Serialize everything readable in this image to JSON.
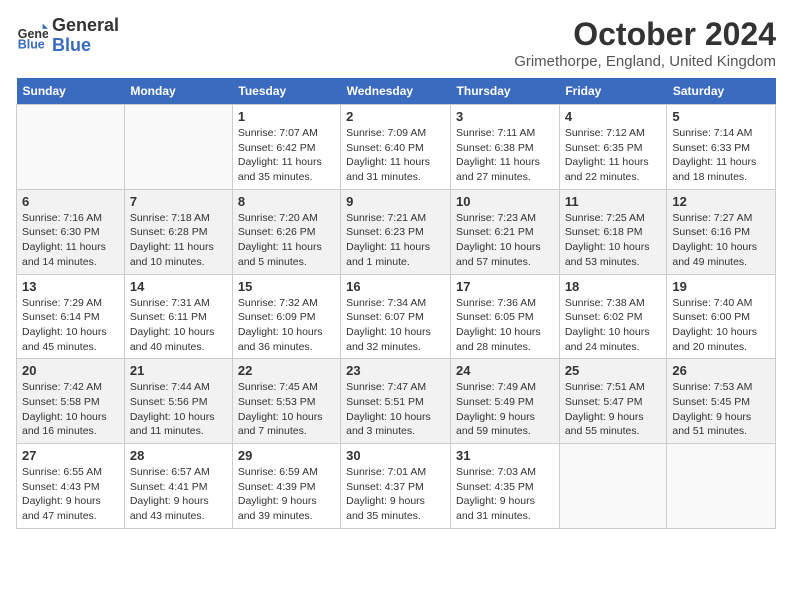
{
  "header": {
    "logo_line1": "General",
    "logo_line2": "Blue",
    "month": "October 2024",
    "location": "Grimethorpe, England, United Kingdom"
  },
  "weekdays": [
    "Sunday",
    "Monday",
    "Tuesday",
    "Wednesday",
    "Thursday",
    "Friday",
    "Saturday"
  ],
  "weeks": [
    [
      {
        "day": null
      },
      {
        "day": null
      },
      {
        "day": "1",
        "sunrise": "Sunrise: 7:07 AM",
        "sunset": "Sunset: 6:42 PM",
        "daylight": "Daylight: 11 hours and 35 minutes."
      },
      {
        "day": "2",
        "sunrise": "Sunrise: 7:09 AM",
        "sunset": "Sunset: 6:40 PM",
        "daylight": "Daylight: 11 hours and 31 minutes."
      },
      {
        "day": "3",
        "sunrise": "Sunrise: 7:11 AM",
        "sunset": "Sunset: 6:38 PM",
        "daylight": "Daylight: 11 hours and 27 minutes."
      },
      {
        "day": "4",
        "sunrise": "Sunrise: 7:12 AM",
        "sunset": "Sunset: 6:35 PM",
        "daylight": "Daylight: 11 hours and 22 minutes."
      },
      {
        "day": "5",
        "sunrise": "Sunrise: 7:14 AM",
        "sunset": "Sunset: 6:33 PM",
        "daylight": "Daylight: 11 hours and 18 minutes."
      }
    ],
    [
      {
        "day": "6",
        "sunrise": "Sunrise: 7:16 AM",
        "sunset": "Sunset: 6:30 PM",
        "daylight": "Daylight: 11 hours and 14 minutes."
      },
      {
        "day": "7",
        "sunrise": "Sunrise: 7:18 AM",
        "sunset": "Sunset: 6:28 PM",
        "daylight": "Daylight: 11 hours and 10 minutes."
      },
      {
        "day": "8",
        "sunrise": "Sunrise: 7:20 AM",
        "sunset": "Sunset: 6:26 PM",
        "daylight": "Daylight: 11 hours and 5 minutes."
      },
      {
        "day": "9",
        "sunrise": "Sunrise: 7:21 AM",
        "sunset": "Sunset: 6:23 PM",
        "daylight": "Daylight: 11 hours and 1 minute."
      },
      {
        "day": "10",
        "sunrise": "Sunrise: 7:23 AM",
        "sunset": "Sunset: 6:21 PM",
        "daylight": "Daylight: 10 hours and 57 minutes."
      },
      {
        "day": "11",
        "sunrise": "Sunrise: 7:25 AM",
        "sunset": "Sunset: 6:18 PM",
        "daylight": "Daylight: 10 hours and 53 minutes."
      },
      {
        "day": "12",
        "sunrise": "Sunrise: 7:27 AM",
        "sunset": "Sunset: 6:16 PM",
        "daylight": "Daylight: 10 hours and 49 minutes."
      }
    ],
    [
      {
        "day": "13",
        "sunrise": "Sunrise: 7:29 AM",
        "sunset": "Sunset: 6:14 PM",
        "daylight": "Daylight: 10 hours and 45 minutes."
      },
      {
        "day": "14",
        "sunrise": "Sunrise: 7:31 AM",
        "sunset": "Sunset: 6:11 PM",
        "daylight": "Daylight: 10 hours and 40 minutes."
      },
      {
        "day": "15",
        "sunrise": "Sunrise: 7:32 AM",
        "sunset": "Sunset: 6:09 PM",
        "daylight": "Daylight: 10 hours and 36 minutes."
      },
      {
        "day": "16",
        "sunrise": "Sunrise: 7:34 AM",
        "sunset": "Sunset: 6:07 PM",
        "daylight": "Daylight: 10 hours and 32 minutes."
      },
      {
        "day": "17",
        "sunrise": "Sunrise: 7:36 AM",
        "sunset": "Sunset: 6:05 PM",
        "daylight": "Daylight: 10 hours and 28 minutes."
      },
      {
        "day": "18",
        "sunrise": "Sunrise: 7:38 AM",
        "sunset": "Sunset: 6:02 PM",
        "daylight": "Daylight: 10 hours and 24 minutes."
      },
      {
        "day": "19",
        "sunrise": "Sunrise: 7:40 AM",
        "sunset": "Sunset: 6:00 PM",
        "daylight": "Daylight: 10 hours and 20 minutes."
      }
    ],
    [
      {
        "day": "20",
        "sunrise": "Sunrise: 7:42 AM",
        "sunset": "Sunset: 5:58 PM",
        "daylight": "Daylight: 10 hours and 16 minutes."
      },
      {
        "day": "21",
        "sunrise": "Sunrise: 7:44 AM",
        "sunset": "Sunset: 5:56 PM",
        "daylight": "Daylight: 10 hours and 11 minutes."
      },
      {
        "day": "22",
        "sunrise": "Sunrise: 7:45 AM",
        "sunset": "Sunset: 5:53 PM",
        "daylight": "Daylight: 10 hours and 7 minutes."
      },
      {
        "day": "23",
        "sunrise": "Sunrise: 7:47 AM",
        "sunset": "Sunset: 5:51 PM",
        "daylight": "Daylight: 10 hours and 3 minutes."
      },
      {
        "day": "24",
        "sunrise": "Sunrise: 7:49 AM",
        "sunset": "Sunset: 5:49 PM",
        "daylight": "Daylight: 9 hours and 59 minutes."
      },
      {
        "day": "25",
        "sunrise": "Sunrise: 7:51 AM",
        "sunset": "Sunset: 5:47 PM",
        "daylight": "Daylight: 9 hours and 55 minutes."
      },
      {
        "day": "26",
        "sunrise": "Sunrise: 7:53 AM",
        "sunset": "Sunset: 5:45 PM",
        "daylight": "Daylight: 9 hours and 51 minutes."
      }
    ],
    [
      {
        "day": "27",
        "sunrise": "Sunrise: 6:55 AM",
        "sunset": "Sunset: 4:43 PM",
        "daylight": "Daylight: 9 hours and 47 minutes."
      },
      {
        "day": "28",
        "sunrise": "Sunrise: 6:57 AM",
        "sunset": "Sunset: 4:41 PM",
        "daylight": "Daylight: 9 hours and 43 minutes."
      },
      {
        "day": "29",
        "sunrise": "Sunrise: 6:59 AM",
        "sunset": "Sunset: 4:39 PM",
        "daylight": "Daylight: 9 hours and 39 minutes."
      },
      {
        "day": "30",
        "sunrise": "Sunrise: 7:01 AM",
        "sunset": "Sunset: 4:37 PM",
        "daylight": "Daylight: 9 hours and 35 minutes."
      },
      {
        "day": "31",
        "sunrise": "Sunrise: 7:03 AM",
        "sunset": "Sunset: 4:35 PM",
        "daylight": "Daylight: 9 hours and 31 minutes."
      },
      {
        "day": null
      },
      {
        "day": null
      }
    ]
  ]
}
